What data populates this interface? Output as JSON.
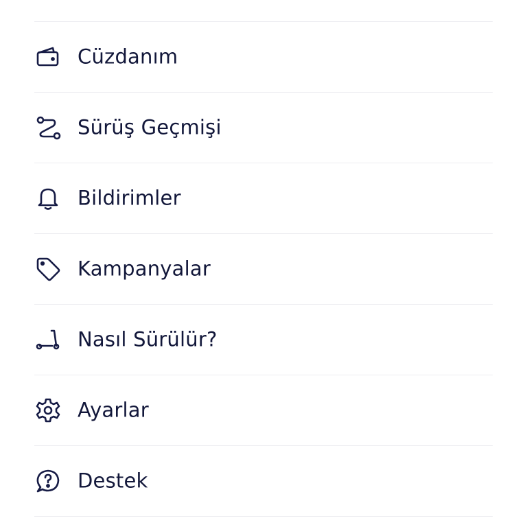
{
  "theme": {
    "text_color": "#12173a",
    "icon_color": "#161b45",
    "divider_color": "#ececf0",
    "background": "#ffffff"
  },
  "menu": {
    "items": [
      {
        "label": "Cüzdanım",
        "icon": "wallet-icon"
      },
      {
        "label": "Sürüş Geçmişi",
        "icon": "route-icon"
      },
      {
        "label": "Bildirimler",
        "icon": "bell-icon"
      },
      {
        "label": "Kampanyalar",
        "icon": "tag-icon"
      },
      {
        "label": "Nasıl Sürülür?",
        "icon": "scooter-icon"
      },
      {
        "label": "Ayarlar",
        "icon": "gear-icon"
      },
      {
        "label": "Destek",
        "icon": "help-icon"
      }
    ]
  }
}
